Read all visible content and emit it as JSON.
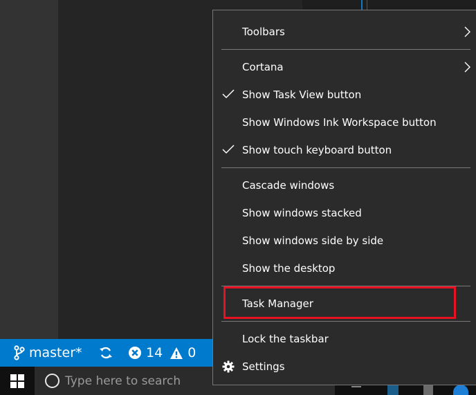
{
  "context_menu": {
    "items": [
      {
        "label": "Toolbars",
        "checked": false,
        "submenu": true
      },
      {
        "label": "Cortana",
        "checked": false,
        "submenu": true
      },
      {
        "label": "Show Task View button",
        "checked": true,
        "submenu": false
      },
      {
        "label": "Show Windows Ink Workspace button",
        "checked": false,
        "submenu": false
      },
      {
        "label": "Show touch keyboard button",
        "checked": true,
        "submenu": false
      },
      {
        "label": "Cascade windows",
        "checked": false,
        "submenu": false
      },
      {
        "label": "Show windows stacked",
        "checked": false,
        "submenu": false
      },
      {
        "label": "Show windows side by side",
        "checked": false,
        "submenu": false
      },
      {
        "label": "Show the desktop",
        "checked": false,
        "submenu": false
      },
      {
        "label": "Task Manager",
        "checked": false,
        "submenu": false,
        "highlighted": true
      },
      {
        "label": "Lock the taskbar",
        "checked": false,
        "submenu": false
      },
      {
        "label": "Settings",
        "checked": false,
        "submenu": false,
        "icon": "gear-icon"
      }
    ]
  },
  "statusbar": {
    "branch": "master*",
    "branch_icon": "git-branch-icon",
    "sync_icon": "sync-icon",
    "errors": "14",
    "error_icon": "error-icon",
    "warnings": "0",
    "warning_icon": "warning-icon"
  },
  "taskbar": {
    "start_icon": "windows-logo-icon",
    "search_placeholder": "Type here to search",
    "search_icon": "cortana-circle-icon"
  },
  "colors": {
    "statusbar_bg": "#007acc",
    "menu_bg": "#2b2b2b",
    "highlight_border": "#e81123",
    "taskbar_bg": "#101010"
  }
}
